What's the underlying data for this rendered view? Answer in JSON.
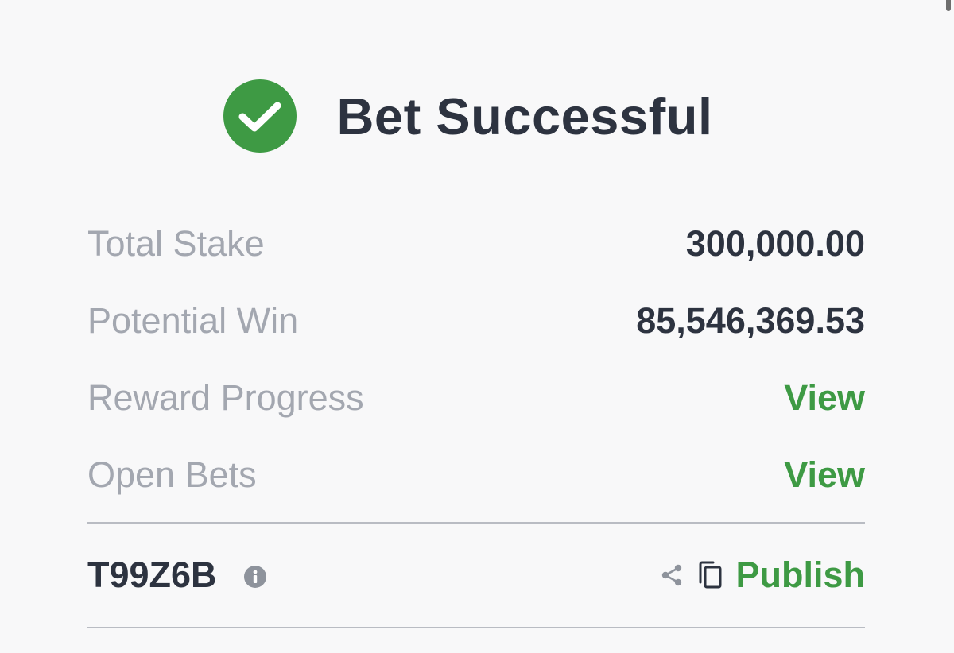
{
  "header": {
    "title": "Bet Successful",
    "icon": "check-circle-icon"
  },
  "summary": {
    "total_stake": {
      "label": "Total Stake",
      "value": "300,000.00"
    },
    "potential_win": {
      "label": "Potential Win",
      "value": "85,546,369.53"
    },
    "reward_progress": {
      "label": "Reward Progress",
      "link": "View"
    },
    "open_bets": {
      "label": "Open Bets",
      "link": "View"
    }
  },
  "booking": {
    "code": "T99Z6B",
    "info_icon": "info-icon",
    "share_icon": "share-icon",
    "copy_icon": "copy-icon",
    "publish_label": "Publish"
  },
  "colors": {
    "success_green": "#3e9a44",
    "text_dark": "#2d3340",
    "text_muted": "#a3a7b0",
    "background": "#f8f8f9"
  }
}
